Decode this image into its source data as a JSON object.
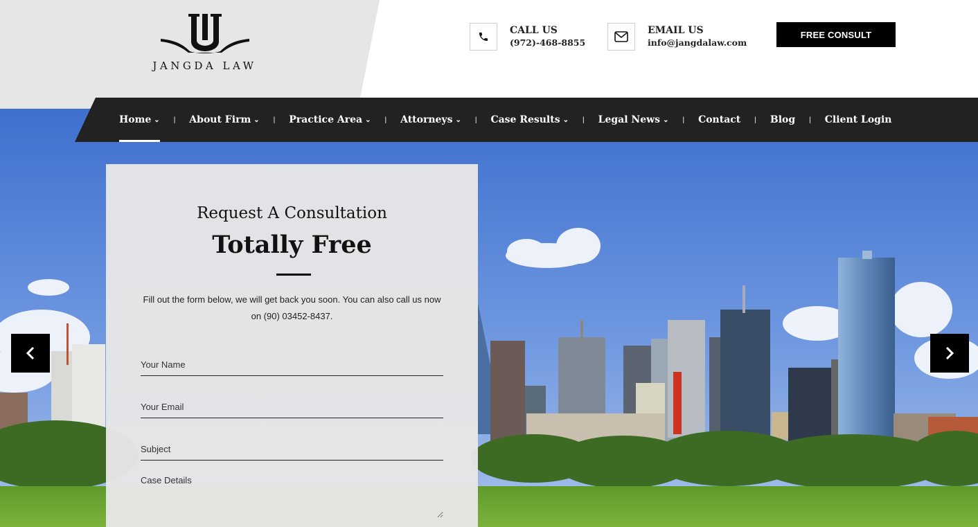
{
  "brand": {
    "name": "JANGDA LAW"
  },
  "header": {
    "call": {
      "label": "CALL US",
      "value": "(972)-468-8855",
      "icon": "phone-icon"
    },
    "email": {
      "label": "EMAIL US",
      "value": "info@jangdalaw.com",
      "icon": "envelope-icon"
    },
    "cta_label": "FREE CONSULT"
  },
  "nav": {
    "items": [
      {
        "label": "Home",
        "dropdown": true,
        "active": true
      },
      {
        "label": "About Firm",
        "dropdown": true
      },
      {
        "label": "Practice Area",
        "dropdown": true
      },
      {
        "label": "Attorneys",
        "dropdown": true
      },
      {
        "label": "Case Results",
        "dropdown": true
      },
      {
        "label": "Legal News",
        "dropdown": true
      },
      {
        "label": "Contact",
        "dropdown": false
      },
      {
        "label": "Blog",
        "dropdown": false
      },
      {
        "label": "Client Login",
        "dropdown": false
      }
    ]
  },
  "form": {
    "title1": "Request A Consultation",
    "title2": "Totally Free",
    "description": "Fill out the form below, we will get back you soon. You can also call us now on (90) 03452-8437.",
    "fields": {
      "name_placeholder": "Your Name",
      "email_placeholder": "Your Email",
      "subject_placeholder": "Subject",
      "details_placeholder": "Case Details"
    }
  },
  "slider": {
    "prev_icon": "chevron-left-icon",
    "next_icon": "chevron-right-icon"
  },
  "colors": {
    "nav_bg": "#222222",
    "header_panel": "#e6e6e6",
    "cta_bg": "#000000",
    "form_bg": "#e6e6e6"
  }
}
